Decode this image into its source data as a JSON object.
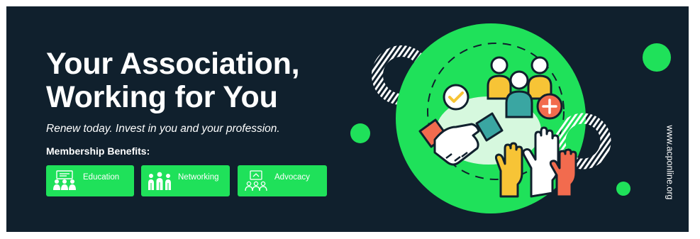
{
  "banner": {
    "headline_line1": "Your Association,",
    "headline_line2": "Working for You",
    "subtitle": "Renew today. Invest in you and your profession.",
    "benefits_heading": "Membership Benefits:",
    "benefits": [
      {
        "label": "Education",
        "icon": "education-icon"
      },
      {
        "label": "Networking",
        "icon": "networking-icon"
      },
      {
        "label": "Advocacy",
        "icon": "advocacy-icon"
      }
    ],
    "website": "www.acponline.org"
  },
  "colors": {
    "background": "#10202d",
    "accent_green": "#1fe15a",
    "text": "#ffffff",
    "yellow": "#f7c436",
    "teal": "#3aa6a2",
    "coral": "#f26b4e"
  },
  "illustration": {
    "icons": [
      "check-badge-icon",
      "people-group-icon",
      "add-person-icon",
      "handshake-icon",
      "raised-hands-icon"
    ]
  }
}
